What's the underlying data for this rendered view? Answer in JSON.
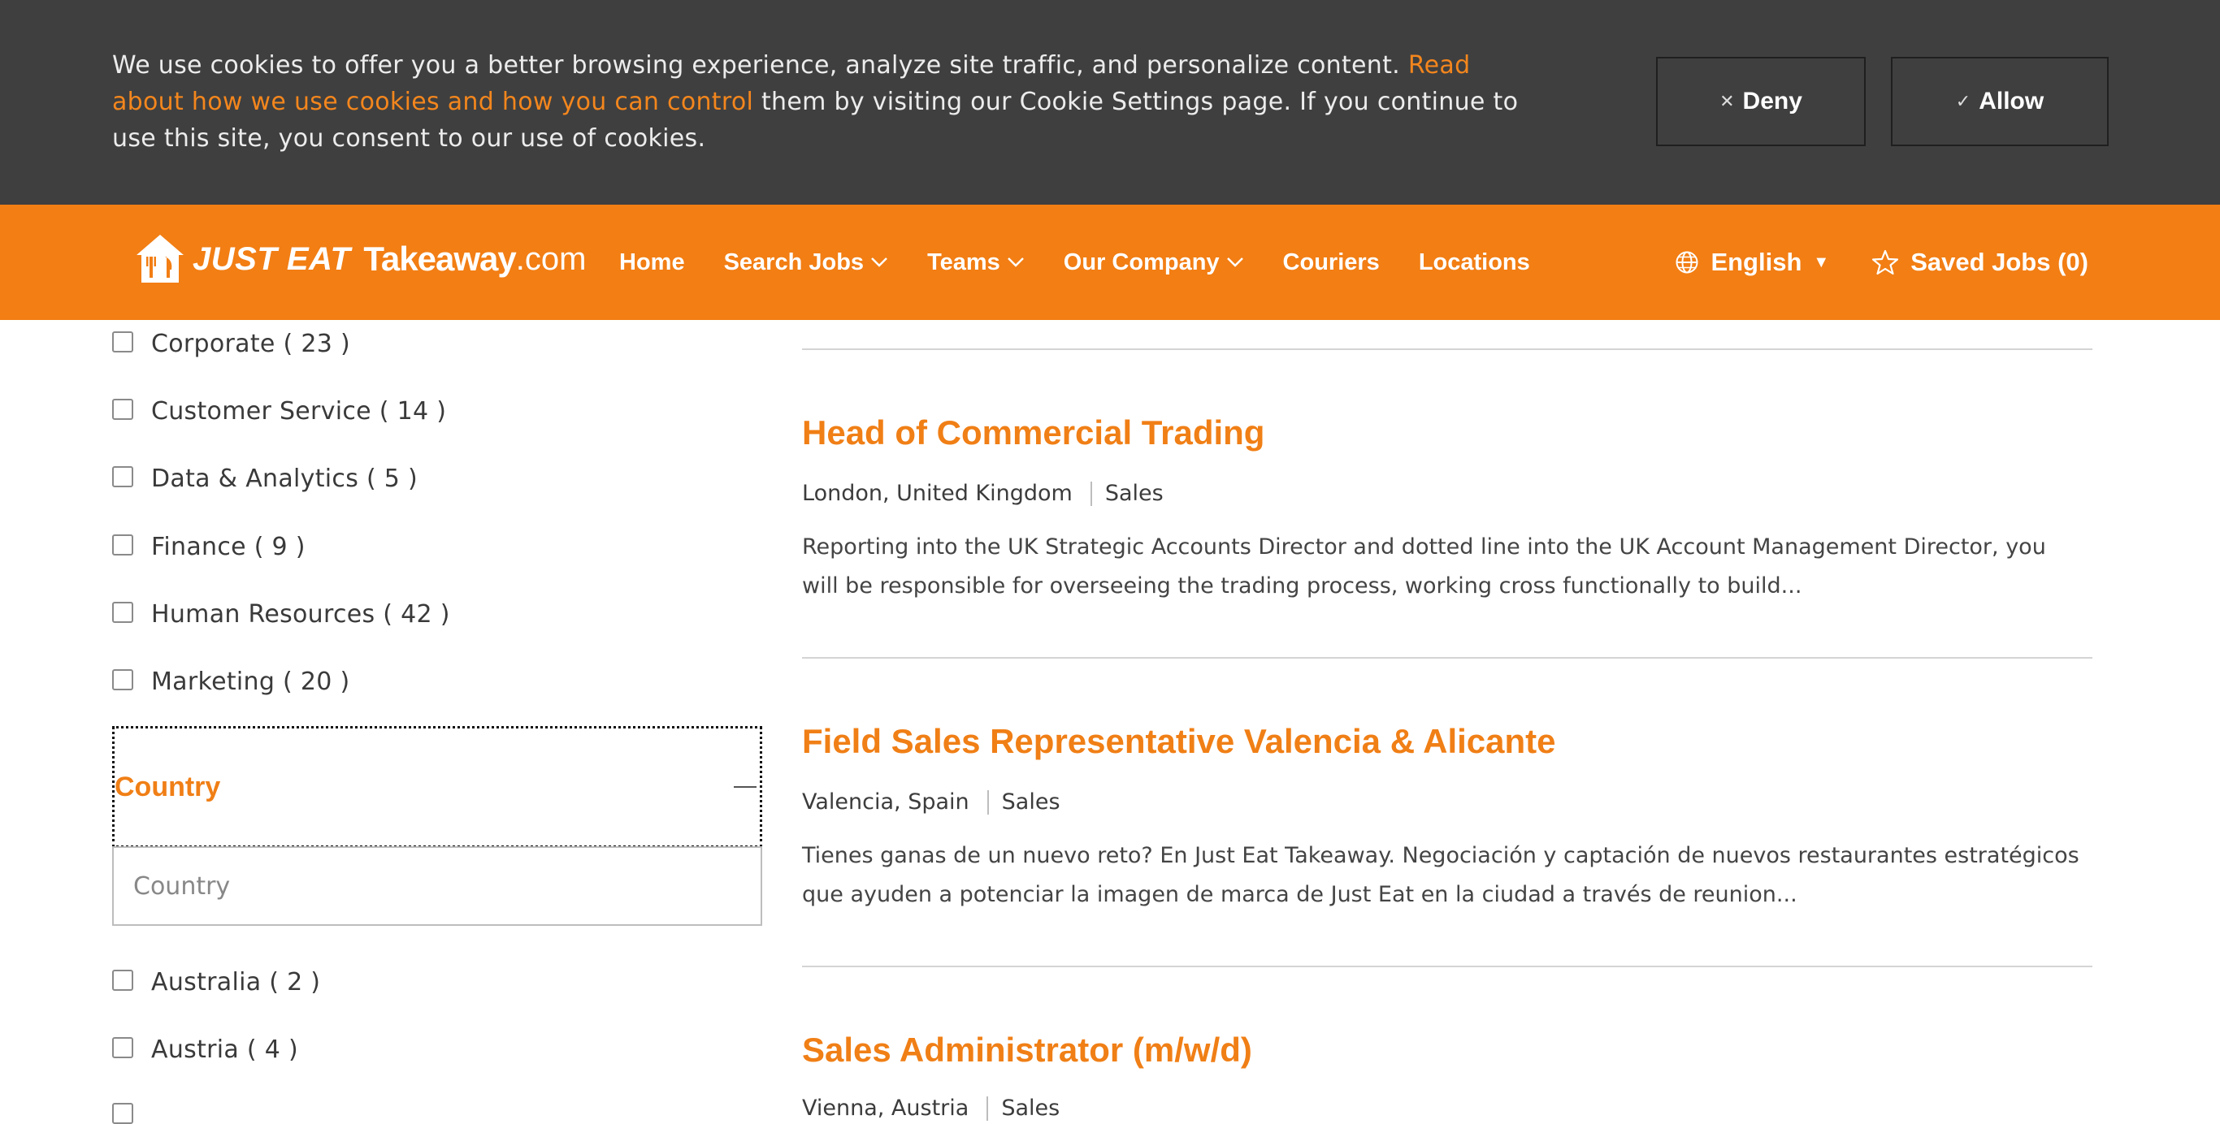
{
  "cookie_banner": {
    "text_before": "We use cookies to offer you a better browsing experience, analyze site traffic, and personalize content. ",
    "link_text": "Read about how we use cookies and how you can control",
    "text_after": " them by visiting our Cookie Settings page. If you continue to use this site, you consent to our use of cookies.",
    "deny_label": "Deny",
    "allow_label": "Allow"
  },
  "header": {
    "logo_text_1": "JUST EAT",
    "logo_text_2": "Takeaway",
    "logo_text_3": ".com",
    "nav": [
      {
        "label": "Home",
        "dropdown": false
      },
      {
        "label": "Search Jobs",
        "dropdown": true
      },
      {
        "label": "Teams",
        "dropdown": true
      },
      {
        "label": "Our Company",
        "dropdown": true
      },
      {
        "label": "Couriers",
        "dropdown": false
      },
      {
        "label": "Locations",
        "dropdown": false
      }
    ],
    "language_label": "English",
    "saved_jobs_label": "Saved Jobs (0)"
  },
  "filters": {
    "categories": [
      {
        "label": "Corporate ( 23 )"
      },
      {
        "label": "Customer Service ( 14 )"
      },
      {
        "label": "Data & Analytics ( 5 )"
      },
      {
        "label": "Finance ( 9 )"
      },
      {
        "label": "Human Resources ( 42 )"
      },
      {
        "label": "Marketing ( 20 )"
      }
    ],
    "country_heading": "Country",
    "country_placeholder": "Country",
    "countries": [
      {
        "label": "Australia ( 2 )"
      },
      {
        "label": "Austria ( 4 )"
      }
    ]
  },
  "jobs": [
    {
      "title": "Head of Commercial Trading",
      "location": "London, United Kingdom",
      "category": "Sales",
      "description": "Reporting into the UK Strategic Accounts Director and dotted line into the UK Account Management Director, you will be responsible for overseeing the trading process, working cross functionally to build..."
    },
    {
      "title": "Field Sales Representative Valencia & Alicante",
      "location": "Valencia, Spain",
      "category": "Sales",
      "description": "Tienes ganas de un nuevo reto? En Just Eat Takeaway. Negociación y captación de nuevos restaurantes estratégicos que ayuden a potenciar la imagen de marca de Just Eat en la ciudad a través de reunion..."
    },
    {
      "title": "Sales Administrator (m/w/d)",
      "location": "Vienna, Austria",
      "category": "Sales",
      "description": ""
    }
  ],
  "colors": {
    "brand_orange": "#f27e14",
    "cookie_bg": "#3f3f3f",
    "link_orange": "#f3861d"
  }
}
